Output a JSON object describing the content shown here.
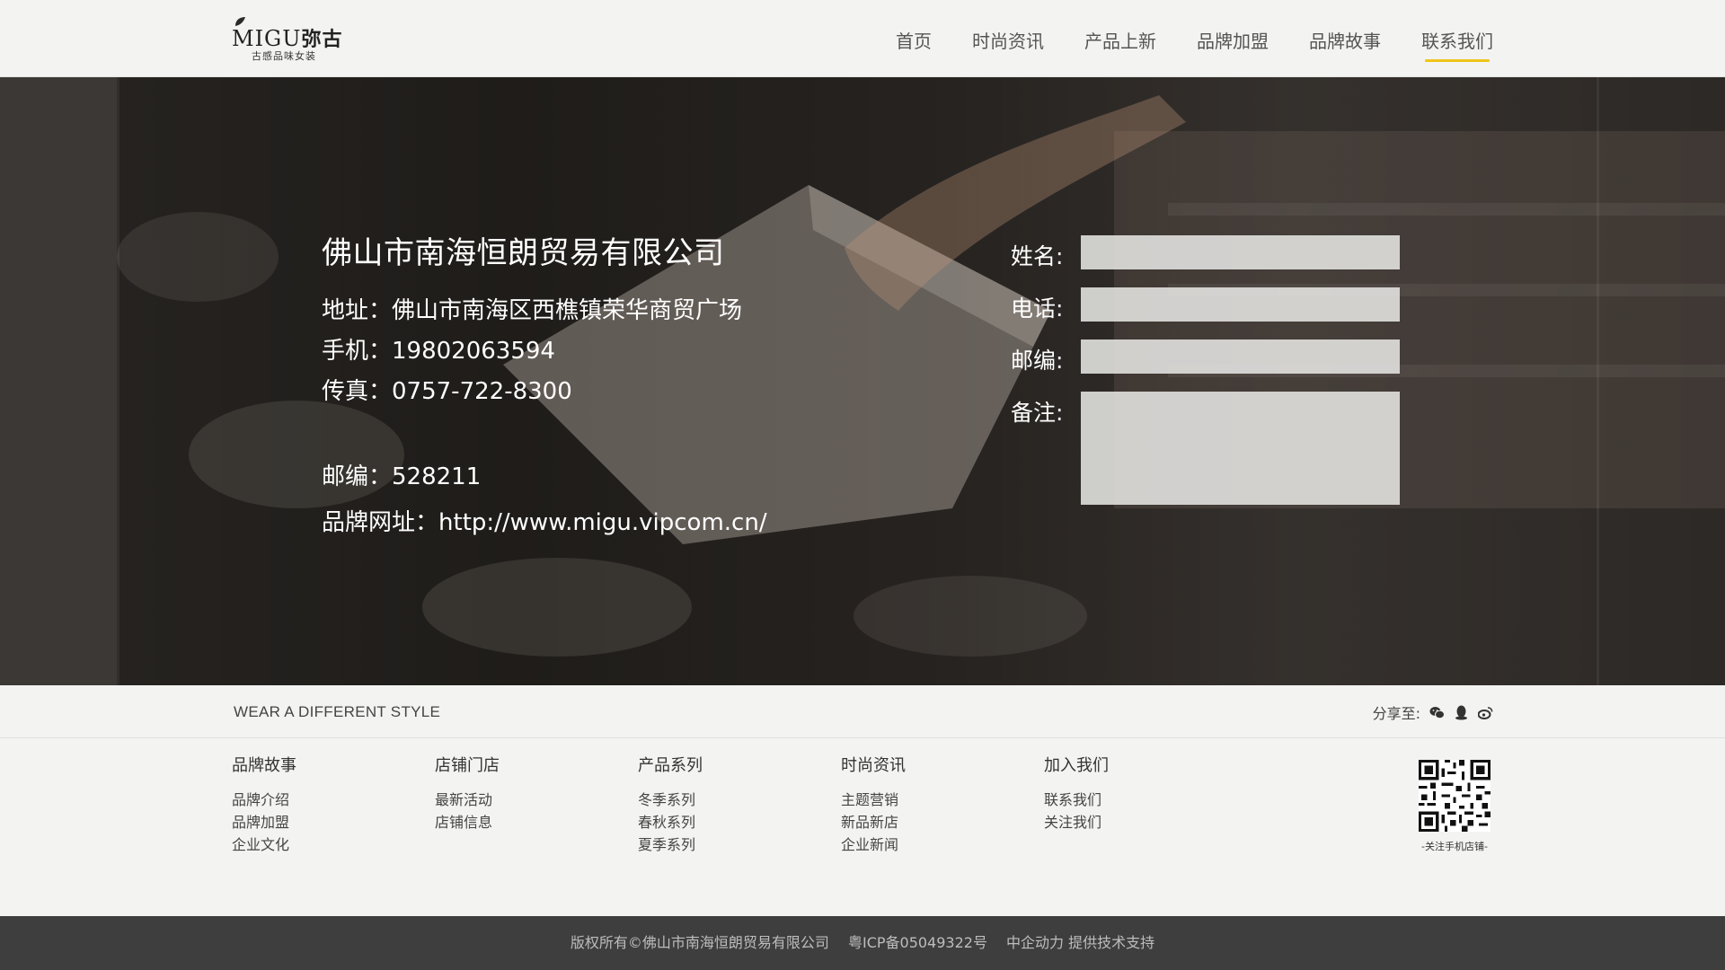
{
  "header": {
    "logo_text": "MIGU",
    "logo_cn": "弥古",
    "logo_tagline": "古感品味女装",
    "nav": [
      {
        "label": "首页"
      },
      {
        "label": "时尚资讯"
      },
      {
        "label": "产品上新"
      },
      {
        "label": "品牌加盟"
      },
      {
        "label": "品牌故事"
      },
      {
        "label": "联系我们"
      }
    ],
    "active_index": 5,
    "accent_color": "#f0c419"
  },
  "contact": {
    "company_name": "佛山市南海恒朗贸易有限公司",
    "address_label": "地址：",
    "address": "佛山市南海区西樵镇荣华商贸广场",
    "mobile_label": "手机：",
    "mobile": "19802063594",
    "fax_label": "传真：",
    "fax": "0757-722-8300",
    "zip_label": "邮编：",
    "zip": "528211",
    "site_label": "品牌网址：",
    "site": "http://www.migu.vipcom.cn/"
  },
  "form": {
    "name_label": "姓名:",
    "phone_label": "电话:",
    "zip_label": "邮编:",
    "note_label": "备注:"
  },
  "footer": {
    "slogan": "WEAR A DIFFERENT STYLE",
    "share_label": "分享至:",
    "share_icons": [
      "wechat-icon",
      "qq-icon",
      "weibo-icon"
    ],
    "columns": [
      {
        "title": "品牌故事",
        "links": [
          "品牌介绍",
          "品牌加盟",
          "企业文化"
        ]
      },
      {
        "title": "店铺门店",
        "links": [
          "最新活动",
          "店铺信息"
        ]
      },
      {
        "title": "产品系列",
        "links": [
          "冬季系列",
          "春秋系列",
          "夏季系列"
        ]
      },
      {
        "title": "时尚资讯",
        "links": [
          "主题营销",
          "新品新店",
          "企业新闻"
        ]
      },
      {
        "title": "加入我们",
        "links": [
          "联系我们",
          "关注我们"
        ]
      }
    ],
    "qr_caption": "-关注手机店铺-",
    "copyright": "版权所有©佛山市南海恒朗贸易有限公司",
    "icp": "粤ICP备05049322号",
    "support": "中企动力 提供技术支持"
  }
}
